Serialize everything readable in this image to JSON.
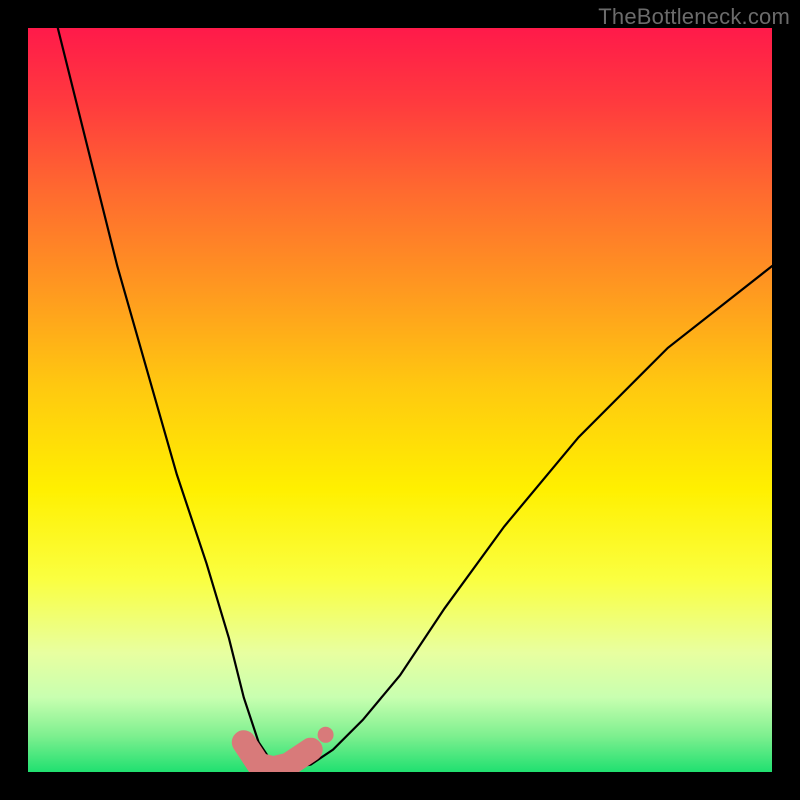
{
  "watermark": "TheBottleneck.com",
  "chart_data": {
    "type": "line",
    "title": "",
    "xlabel": "",
    "ylabel": "",
    "xlim": [
      0,
      100
    ],
    "ylim": [
      0,
      100
    ],
    "series": [
      {
        "name": "bottleneck-curve",
        "x": [
          4,
          8,
          12,
          16,
          20,
          24,
          27,
          29,
          31,
          33,
          35,
          38,
          41,
          45,
          50,
          56,
          64,
          74,
          86,
          100
        ],
        "y": [
          100,
          84,
          68,
          54,
          40,
          28,
          18,
          10,
          4,
          1,
          0.5,
          1,
          3,
          7,
          13,
          22,
          33,
          45,
          57,
          68
        ]
      }
    ],
    "highlight_band": {
      "name": "optimal-range",
      "x": [
        29,
        31,
        33,
        35,
        38
      ],
      "y": [
        4,
        1,
        0.5,
        1,
        3
      ],
      "color": "#d87a7a"
    },
    "gradient_stops": [
      {
        "pos": 0.0,
        "color": "#ff1a4a"
      },
      {
        "pos": 0.35,
        "color": "#ff9820"
      },
      {
        "pos": 0.62,
        "color": "#fff000"
      },
      {
        "pos": 0.84,
        "color": "#e8ffa0"
      },
      {
        "pos": 1.0,
        "color": "#20e070"
      }
    ]
  }
}
